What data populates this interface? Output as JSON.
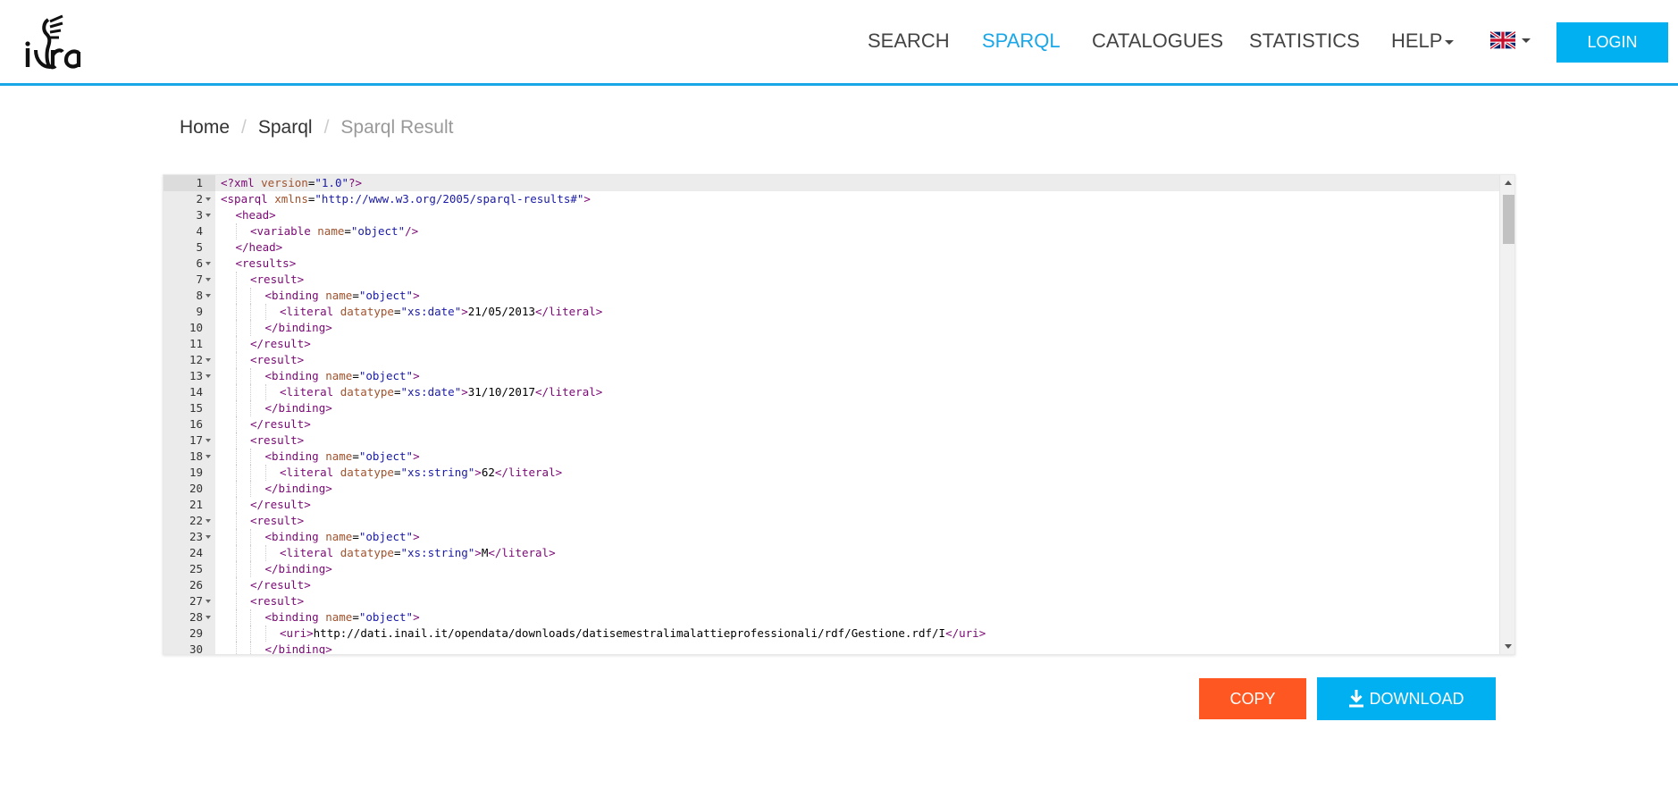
{
  "brand": {
    "logo_text": "idra"
  },
  "nav": {
    "search": "SEARCH",
    "sparql": "SPARQL",
    "catalogues": "CATALOGUES",
    "statistics": "STATISTICS",
    "help": "HELP",
    "language_icon": "uk-flag-icon",
    "login": "LOGIN"
  },
  "breadcrumb": {
    "home": "Home",
    "sparql": "Sparql",
    "current": "Sparql Result"
  },
  "editor": {
    "lines": [
      {
        "n": "1",
        "fold": false,
        "indent": 0,
        "tokens": [
          [
            "decl",
            "<?xml "
          ],
          [
            "attr",
            "version"
          ],
          [
            "eq",
            "="
          ],
          [
            "str",
            "\"1.0\""
          ],
          [
            "decl",
            "?>"
          ]
        ]
      },
      {
        "n": "2",
        "fold": true,
        "indent": 0,
        "tokens": [
          [
            "tag",
            "<sparql "
          ],
          [
            "attr",
            "xmlns"
          ],
          [
            "eq",
            "="
          ],
          [
            "str",
            "\"http://www.w3.org/2005/sparql-results#\""
          ],
          [
            "tag",
            ">"
          ]
        ]
      },
      {
        "n": "3",
        "fold": true,
        "indent": 1,
        "tokens": [
          [
            "tag",
            "<head>"
          ]
        ]
      },
      {
        "n": "4",
        "fold": false,
        "indent": 2,
        "tokens": [
          [
            "tag",
            "<variable "
          ],
          [
            "attr",
            "name"
          ],
          [
            "eq",
            "="
          ],
          [
            "str",
            "\"object\""
          ],
          [
            "tag",
            "/>"
          ]
        ]
      },
      {
        "n": "5",
        "fold": false,
        "indent": 1,
        "tokens": [
          [
            "tag",
            "</head>"
          ]
        ]
      },
      {
        "n": "6",
        "fold": true,
        "indent": 1,
        "tokens": [
          [
            "tag",
            "<results>"
          ]
        ]
      },
      {
        "n": "7",
        "fold": true,
        "indent": 2,
        "tokens": [
          [
            "tag",
            "<result>"
          ]
        ]
      },
      {
        "n": "8",
        "fold": true,
        "indent": 3,
        "tokens": [
          [
            "tag",
            "<binding "
          ],
          [
            "attr",
            "name"
          ],
          [
            "eq",
            "="
          ],
          [
            "str",
            "\"object\""
          ],
          [
            "tag",
            ">"
          ]
        ]
      },
      {
        "n": "9",
        "fold": false,
        "indent": 4,
        "tokens": [
          [
            "tag",
            "<literal "
          ],
          [
            "attr",
            "datatype"
          ],
          [
            "eq",
            "="
          ],
          [
            "str",
            "\"xs:date\""
          ],
          [
            "tag",
            ">"
          ],
          [
            "txt",
            "21/05/2013"
          ],
          [
            "tag",
            "</literal>"
          ]
        ]
      },
      {
        "n": "10",
        "fold": false,
        "indent": 3,
        "tokens": [
          [
            "tag",
            "</binding>"
          ]
        ]
      },
      {
        "n": "11",
        "fold": false,
        "indent": 2,
        "tokens": [
          [
            "tag",
            "</result>"
          ]
        ]
      },
      {
        "n": "12",
        "fold": true,
        "indent": 2,
        "tokens": [
          [
            "tag",
            "<result>"
          ]
        ]
      },
      {
        "n": "13",
        "fold": true,
        "indent": 3,
        "tokens": [
          [
            "tag",
            "<binding "
          ],
          [
            "attr",
            "name"
          ],
          [
            "eq",
            "="
          ],
          [
            "str",
            "\"object\""
          ],
          [
            "tag",
            ">"
          ]
        ]
      },
      {
        "n": "14",
        "fold": false,
        "indent": 4,
        "tokens": [
          [
            "tag",
            "<literal "
          ],
          [
            "attr",
            "datatype"
          ],
          [
            "eq",
            "="
          ],
          [
            "str",
            "\"xs:date\""
          ],
          [
            "tag",
            ">"
          ],
          [
            "txt",
            "31/10/2017"
          ],
          [
            "tag",
            "</literal>"
          ]
        ]
      },
      {
        "n": "15",
        "fold": false,
        "indent": 3,
        "tokens": [
          [
            "tag",
            "</binding>"
          ]
        ]
      },
      {
        "n": "16",
        "fold": false,
        "indent": 2,
        "tokens": [
          [
            "tag",
            "</result>"
          ]
        ]
      },
      {
        "n": "17",
        "fold": true,
        "indent": 2,
        "tokens": [
          [
            "tag",
            "<result>"
          ]
        ]
      },
      {
        "n": "18",
        "fold": true,
        "indent": 3,
        "tokens": [
          [
            "tag",
            "<binding "
          ],
          [
            "attr",
            "name"
          ],
          [
            "eq",
            "="
          ],
          [
            "str",
            "\"object\""
          ],
          [
            "tag",
            ">"
          ]
        ]
      },
      {
        "n": "19",
        "fold": false,
        "indent": 4,
        "tokens": [
          [
            "tag",
            "<literal "
          ],
          [
            "attr",
            "datatype"
          ],
          [
            "eq",
            "="
          ],
          [
            "str",
            "\"xs:string\""
          ],
          [
            "tag",
            ">"
          ],
          [
            "txt",
            "62"
          ],
          [
            "tag",
            "</literal>"
          ]
        ]
      },
      {
        "n": "20",
        "fold": false,
        "indent": 3,
        "tokens": [
          [
            "tag",
            "</binding>"
          ]
        ]
      },
      {
        "n": "21",
        "fold": false,
        "indent": 2,
        "tokens": [
          [
            "tag",
            "</result>"
          ]
        ]
      },
      {
        "n": "22",
        "fold": true,
        "indent": 2,
        "tokens": [
          [
            "tag",
            "<result>"
          ]
        ]
      },
      {
        "n": "23",
        "fold": true,
        "indent": 3,
        "tokens": [
          [
            "tag",
            "<binding "
          ],
          [
            "attr",
            "name"
          ],
          [
            "eq",
            "="
          ],
          [
            "str",
            "\"object\""
          ],
          [
            "tag",
            ">"
          ]
        ]
      },
      {
        "n": "24",
        "fold": false,
        "indent": 4,
        "tokens": [
          [
            "tag",
            "<literal "
          ],
          [
            "attr",
            "datatype"
          ],
          [
            "eq",
            "="
          ],
          [
            "str",
            "\"xs:string\""
          ],
          [
            "tag",
            ">"
          ],
          [
            "txt",
            "M"
          ],
          [
            "tag",
            "</literal>"
          ]
        ]
      },
      {
        "n": "25",
        "fold": false,
        "indent": 3,
        "tokens": [
          [
            "tag",
            "</binding>"
          ]
        ]
      },
      {
        "n": "26",
        "fold": false,
        "indent": 2,
        "tokens": [
          [
            "tag",
            "</result>"
          ]
        ]
      },
      {
        "n": "27",
        "fold": true,
        "indent": 2,
        "tokens": [
          [
            "tag",
            "<result>"
          ]
        ]
      },
      {
        "n": "28",
        "fold": true,
        "indent": 3,
        "tokens": [
          [
            "tag",
            "<binding "
          ],
          [
            "attr",
            "name"
          ],
          [
            "eq",
            "="
          ],
          [
            "str",
            "\"object\""
          ],
          [
            "tag",
            ">"
          ]
        ]
      },
      {
        "n": "29",
        "fold": false,
        "indent": 4,
        "tokens": [
          [
            "tag",
            "<uri>"
          ],
          [
            "txt",
            "http://dati.inail.it/opendata/downloads/datisemestralimalattieprofessionali/rdf/Gestione.rdf/I"
          ],
          [
            "tag",
            "</uri>"
          ]
        ]
      },
      {
        "n": "30",
        "fold": false,
        "indent": 3,
        "tokens": [
          [
            "tag",
            "</binding>"
          ]
        ]
      }
    ]
  },
  "actions": {
    "copy": "COPY",
    "download": "DOWNLOAD",
    "download_icon": "download-icon"
  },
  "colors": {
    "accent": "#1aa7e8",
    "login": "#00b0f0",
    "copy": "#ff5722",
    "download": "#00b0f0"
  }
}
